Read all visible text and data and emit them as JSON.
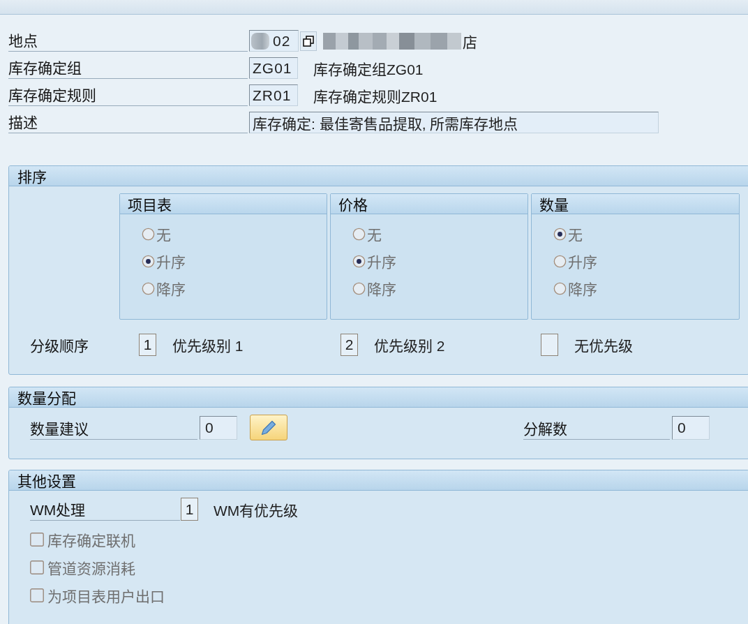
{
  "header_fields": [
    {
      "kind": "plant",
      "label": "地点",
      "value": "02",
      "description": "店"
    },
    {
      "kind": "code",
      "label": "库存确定组",
      "value": "ZG01",
      "description": "库存确定组ZG01"
    },
    {
      "kind": "code",
      "label": "库存确定规则",
      "value": "ZR01",
      "description": "库存确定规则ZR01"
    },
    {
      "kind": "text",
      "label": "描述",
      "value": "库存确定: 最佳寄售品提取, 所需库存地点"
    }
  ],
  "sorting": {
    "title": "排序",
    "groups": [
      {
        "title": "项目表",
        "options": [
          {
            "label": "无",
            "selected": false,
            "disabled": true
          },
          {
            "label": "升序",
            "selected": true,
            "disabled": true
          },
          {
            "label": "降序",
            "selected": false,
            "disabled": true
          }
        ]
      },
      {
        "title": "价格",
        "options": [
          {
            "label": "无",
            "selected": false,
            "disabled": true
          },
          {
            "label": "升序",
            "selected": true,
            "disabled": true
          },
          {
            "label": "降序",
            "selected": false,
            "disabled": true
          }
        ]
      },
      {
        "title": "数量",
        "options": [
          {
            "label": "无",
            "selected": true,
            "disabled": true
          },
          {
            "label": "升序",
            "selected": false,
            "disabled": true
          },
          {
            "label": "降序",
            "selected": false,
            "disabled": true
          }
        ]
      }
    ],
    "ranking": {
      "label": "分级顺序",
      "items": [
        {
          "value": "1",
          "text": "优先级别 1"
        },
        {
          "value": "2",
          "text": "优先级别 2"
        },
        {
          "text": "无优先级"
        }
      ]
    }
  },
  "quantity_allocation": {
    "title": "数量分配",
    "fields": [
      {
        "kind": "with_edit",
        "label": "数量建议",
        "value": "0"
      },
      {
        "kind": "plain",
        "label": "分解数",
        "value": "0"
      }
    ]
  },
  "other_settings": {
    "title": "其他设置",
    "wm": {
      "label": "WM处理",
      "value": "1",
      "text": "WM有优先级"
    },
    "checkboxes": [
      {
        "label": "库存确定联机",
        "checked": false,
        "disabled": true
      },
      {
        "label": "管道资源消耗",
        "checked": false,
        "disabled": true
      },
      {
        "label": "为项目表用户出口",
        "checked": false,
        "disabled": true
      }
    ]
  }
}
